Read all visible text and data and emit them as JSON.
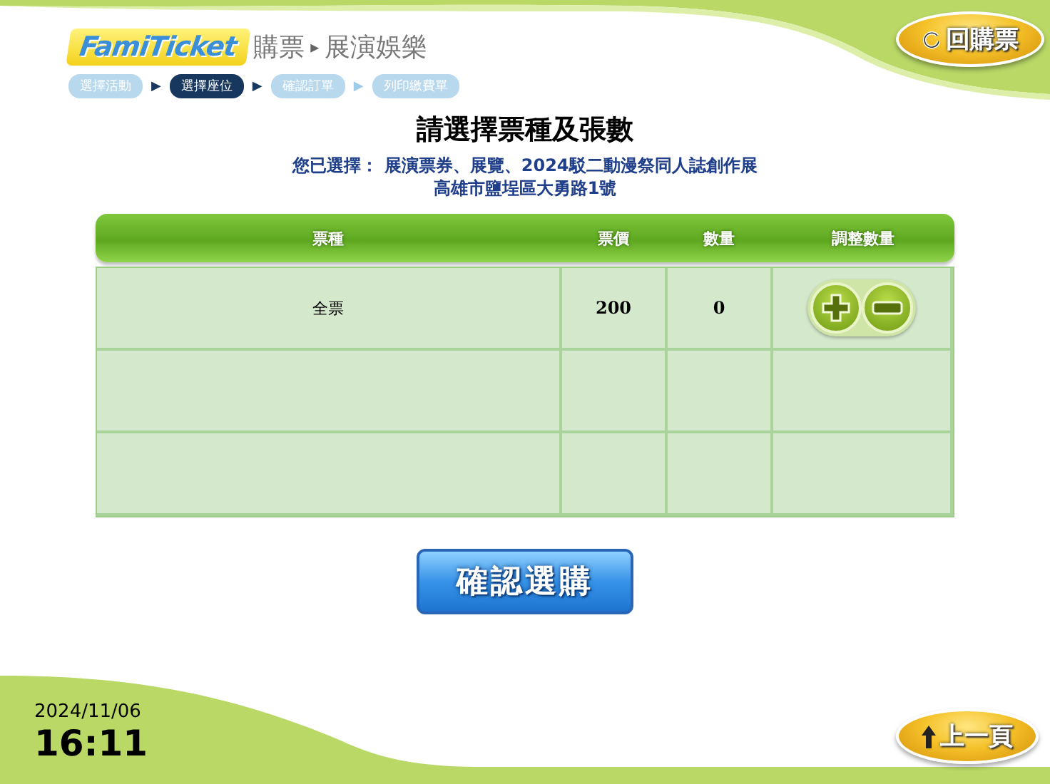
{
  "header": {
    "logo": "FamiTicket",
    "breadcrumb": [
      "購票",
      "展演娛樂"
    ],
    "separator": "▸",
    "home_button": "回購票"
  },
  "steps": [
    {
      "label": "選擇活動",
      "selected": false
    },
    {
      "label": "選擇座位",
      "selected": true
    },
    {
      "label": "確認訂單",
      "selected": false
    },
    {
      "label": "列印繳費單",
      "selected": false
    }
  ],
  "step_arrow": "▶",
  "title": "請選擇票種及張數",
  "selection": {
    "label": "您已選擇：",
    "event": "展演票券、展覽、2024駁二動漫祭同人誌創作展",
    "venue": "高雄市鹽埕區大勇路1號"
  },
  "table": {
    "columns": [
      "票種",
      "票價",
      "數量",
      "調整數量"
    ],
    "rows": [
      {
        "type": "全票",
        "price": "200",
        "quantity": "0"
      }
    ]
  },
  "confirm_button": "確認選購",
  "footer": {
    "date": "2024/11/06",
    "time": "16:11",
    "back_button": "上一頁"
  }
}
